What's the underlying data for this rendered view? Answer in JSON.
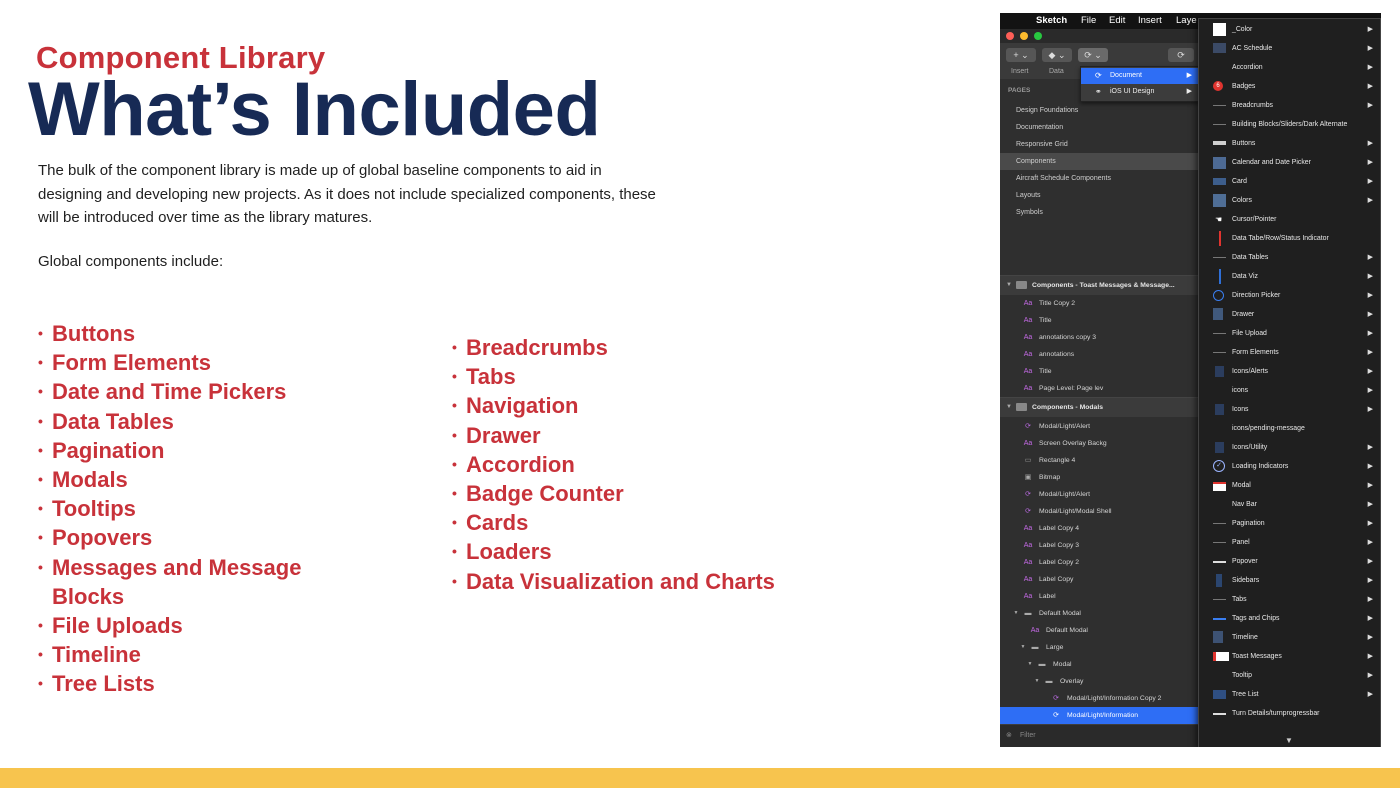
{
  "slide": {
    "subtitle": "Component Library",
    "title": "What’s Included",
    "paragraph": "The bulk of the component library is made up of global baseline components to aid in designing and developing new projects. As it does not include specialized components, these will be introduced over time as the library matures.",
    "intro": "Global components include:",
    "bullet_glyph": "•",
    "left_list": [
      "Buttons",
      "Form Elements",
      "Date and Time Pickers",
      "Data Tables",
      "Pagination",
      "Modals",
      "Tooltips",
      "Popovers",
      "Messages and Message Blocks",
      "File Uploads",
      "Timeline",
      "Tree Lists"
    ],
    "right_list": [
      "Breadcrumbs",
      "Tabs",
      "Navigation",
      "Drawer",
      "Accordion",
      "Badge Counter",
      "Cards",
      "Loaders",
      "Data Visualization and Charts"
    ],
    "colors": {
      "accent": "#c8323a",
      "title": "#172a55",
      "band": "#f7c44e"
    }
  },
  "sketch": {
    "menubar": {
      "apple": "",
      "app": "Sketch",
      "items": [
        "File",
        "Edit",
        "Insert",
        "Laye"
      ]
    },
    "toolbar": {
      "insert_label": "Insert",
      "data_label": "Data",
      "add_glyph": "+",
      "sync_glyph": "⟳"
    },
    "submenu": [
      {
        "label": "Document",
        "icon": "sync-icon"
      },
      {
        "label": "iOS UI Design",
        "icon": "link-icon"
      }
    ],
    "pages_header": "PAGES",
    "pages": [
      "Design Foundations",
      "Documentation",
      "Responsive Grid",
      "Components",
      "Aircraft Schedule Components",
      "Layouts",
      "Symbols"
    ],
    "selected_page": "Components",
    "groups": [
      {
        "label": "Components - Toast Messages & Message..."
      },
      {
        "label": "Components - Modals"
      }
    ],
    "layers_group1": [
      {
        "label": "Title Copy 2",
        "icon": "text-icon"
      },
      {
        "label": "Title",
        "icon": "text-icon"
      },
      {
        "label": "annotations copy 3",
        "icon": "text-icon"
      },
      {
        "label": "annotations",
        "icon": "text-icon"
      },
      {
        "label": "Title",
        "icon": "text-icon"
      },
      {
        "label": "Page Level: Page lev",
        "icon": "text-icon"
      }
    ],
    "layers_group2": [
      {
        "label": "Modal/Light/Alert",
        "icon": "symbol-icon"
      },
      {
        "label": "Screen Overlay Backg",
        "icon": "text-icon"
      },
      {
        "label": "Rectangle 4",
        "icon": "rectangle-icon"
      },
      {
        "label": "Bitmap",
        "icon": "image-icon"
      },
      {
        "label": "Modal/Light/Alert",
        "icon": "symbol-icon"
      },
      {
        "label": "Modal/Light/Modal Shell",
        "icon": "symbol-icon"
      },
      {
        "label": "Label Copy 4",
        "icon": "text-icon"
      },
      {
        "label": "Label Copy 3",
        "icon": "text-icon"
      },
      {
        "label": "Label Copy 2",
        "icon": "text-icon"
      },
      {
        "label": "Label Copy",
        "icon": "text-icon"
      },
      {
        "label": "Label",
        "icon": "text-icon"
      },
      {
        "label": "Default Modal",
        "icon": "folder-icon"
      },
      {
        "label": "Default Modal",
        "icon": "text-icon"
      },
      {
        "label": "Large",
        "icon": "folder-icon"
      },
      {
        "label": "Modal",
        "icon": "folder-icon"
      },
      {
        "label": "Overlay",
        "icon": "folder-icon"
      },
      {
        "label": "Modal/Light/Information Copy 2",
        "icon": "symbol-icon"
      },
      {
        "label": "Modal/Light/Information",
        "icon": "symbol-icon"
      }
    ],
    "selected_layer": "Modal/Light/Information",
    "filter_label": "Filter",
    "symbol_menu": [
      {
        "label": "_Color",
        "arrow": true,
        "thumb": "white-swatch"
      },
      {
        "label": "AC Schedule",
        "arrow": true,
        "thumb": "schedule-thumb"
      },
      {
        "label": "Accordion",
        "arrow": true,
        "thumb": "none"
      },
      {
        "label": "Badges",
        "arrow": true,
        "thumb": "badge-thumb",
        "badge_count": "6"
      },
      {
        "label": "Breadcrumbs",
        "arrow": true,
        "thumb": "line-thumb"
      },
      {
        "label": "Building Blocks/Sliders/Dark Alternate",
        "arrow": false,
        "thumb": "line-thumb"
      },
      {
        "label": "Buttons",
        "arrow": true,
        "thumb": "button-thumb"
      },
      {
        "label": "Calendar and Date Picker",
        "arrow": true,
        "thumb": "calendar-thumb"
      },
      {
        "label": "Card",
        "arrow": true,
        "thumb": "card-thumb"
      },
      {
        "label": "Colors",
        "arrow": true,
        "thumb": "blue-swatch"
      },
      {
        "label": "Cursor/Pointer",
        "arrow": false,
        "thumb": "cursor-thumb"
      },
      {
        "label": "Data Tabe/Row/Status Indicator",
        "arrow": false,
        "thumb": "red-line-thumb"
      },
      {
        "label": "Data Tables",
        "arrow": true,
        "thumb": "line-thumb"
      },
      {
        "label": "Data Viz",
        "arrow": true,
        "thumb": "vline-thumb"
      },
      {
        "label": "Direction Picker",
        "arrow": true,
        "thumb": "direction-thumb"
      },
      {
        "label": "Drawer",
        "arrow": true,
        "thumb": "drawer-thumb"
      },
      {
        "label": "File Upload",
        "arrow": true,
        "thumb": "line-thumb"
      },
      {
        "label": "Form Elements",
        "arrow": true,
        "thumb": "line-thumb"
      },
      {
        "label": "Icons/Alerts",
        "arrow": true,
        "thumb": "dots-thumb"
      },
      {
        "label": "icons",
        "arrow": true,
        "thumb": "none"
      },
      {
        "label": "Icons",
        "arrow": true,
        "thumb": "dots-thumb"
      },
      {
        "label": "icons/pending-message",
        "arrow": false,
        "thumb": "none"
      },
      {
        "label": "Icons/Utility",
        "arrow": true,
        "thumb": "dots-thumb"
      },
      {
        "label": "Loading Indicators",
        "arrow": true,
        "thumb": "check-thumb"
      },
      {
        "label": "Modal",
        "arrow": true,
        "thumb": "modal-thumb"
      },
      {
        "label": "Nav Bar",
        "arrow": true,
        "thumb": "none"
      },
      {
        "label": "Pagination",
        "arrow": true,
        "thumb": "line-thumb"
      },
      {
        "label": "Panel",
        "arrow": true,
        "thumb": "line-thumb"
      },
      {
        "label": "Popover",
        "arrow": true,
        "thumb": "white-line-thumb"
      },
      {
        "label": "Sidebars",
        "arrow": true,
        "thumb": "sidebar-thumb"
      },
      {
        "label": "Tabs",
        "arrow": true,
        "thumb": "line-thumb"
      },
      {
        "label": "Tags and Chips",
        "arrow": true,
        "thumb": "blue-line-thumb"
      },
      {
        "label": "Timeline",
        "arrow": true,
        "thumb": "timeline-thumb"
      },
      {
        "label": "Toast Messages",
        "arrow": true,
        "thumb": "toast-thumb"
      },
      {
        "label": "Tooltip",
        "arrow": true,
        "thumb": "none"
      },
      {
        "label": "Tree List",
        "arrow": true,
        "thumb": "tree-thumb"
      },
      {
        "label": "Turn Details/turnprogressbar",
        "arrow": false,
        "thumb": "white-line-thumb"
      }
    ],
    "arrow_glyph": "▶",
    "more_glyph": "▼"
  }
}
